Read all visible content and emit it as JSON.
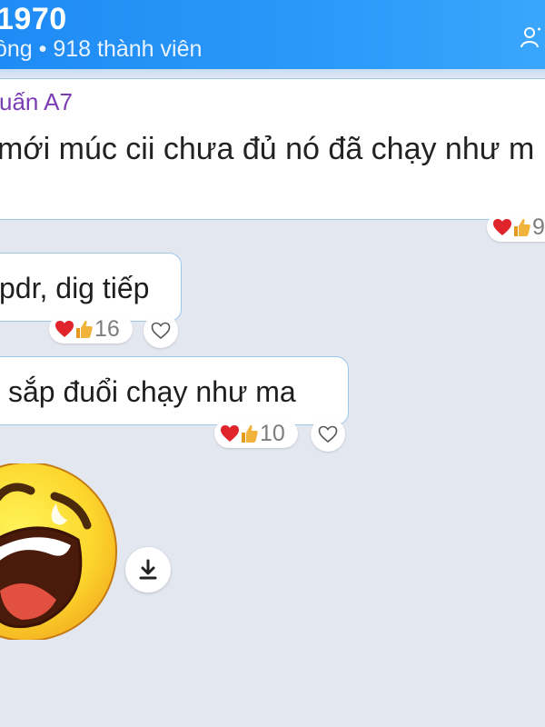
{
  "header": {
    "title": "1970",
    "subtitle": "ồng • 918 thành viên"
  },
  "quoted_message": {
    "sender": "uấn A7",
    "text": "mới múc cii chưa đủ nó đã chạy như m",
    "reaction_count": "9"
  },
  "messages": [
    {
      "text": "pdr, dig tiếp",
      "reaction_count": "16"
    },
    {
      "text": "sắp đuổi chạy như ma",
      "reaction_count": "10"
    }
  ],
  "sticker": {
    "icon": "laughing-face-sticker"
  },
  "colors": {
    "header": "#2494f7",
    "background": "#e3e7f0",
    "bubble_border": "#9cc8ec",
    "sender_name": "#7b3db3",
    "heart": "#e0242c",
    "thumb": "#f2b33d"
  }
}
